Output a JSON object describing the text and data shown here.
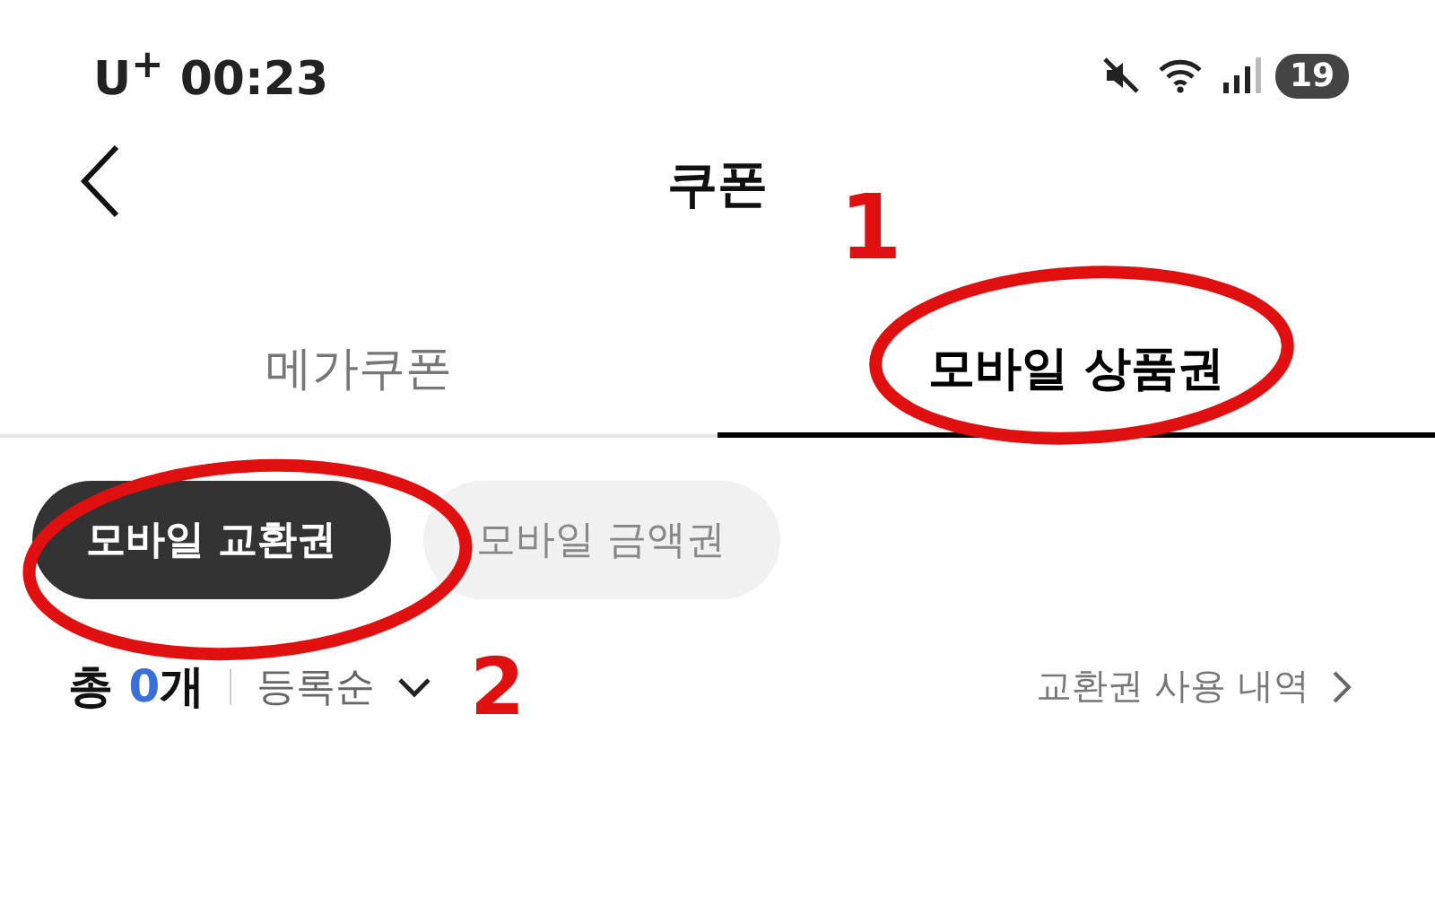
{
  "status_bar": {
    "carrier_time": "U$^{+}$ 00:23",
    "battery": "19"
  },
  "header": {
    "title": "쿠폰"
  },
  "tabs": [
    {
      "label": "메가쿠폰",
      "selected": false
    },
    {
      "label": "모바일 상품권",
      "selected": true
    }
  ],
  "chips": [
    {
      "label": "모바일 교환권",
      "selected": true
    },
    {
      "label": "모바일 금액권",
      "selected": false
    }
  ],
  "summary": {
    "total": "총 **0**개",
    "sort": "등록순",
    "history_link": "교환권 사용 내역"
  },
  "annotations": [
    {
      "label": "1"
    },
    {
      "label": "2"
    }
  ]
}
